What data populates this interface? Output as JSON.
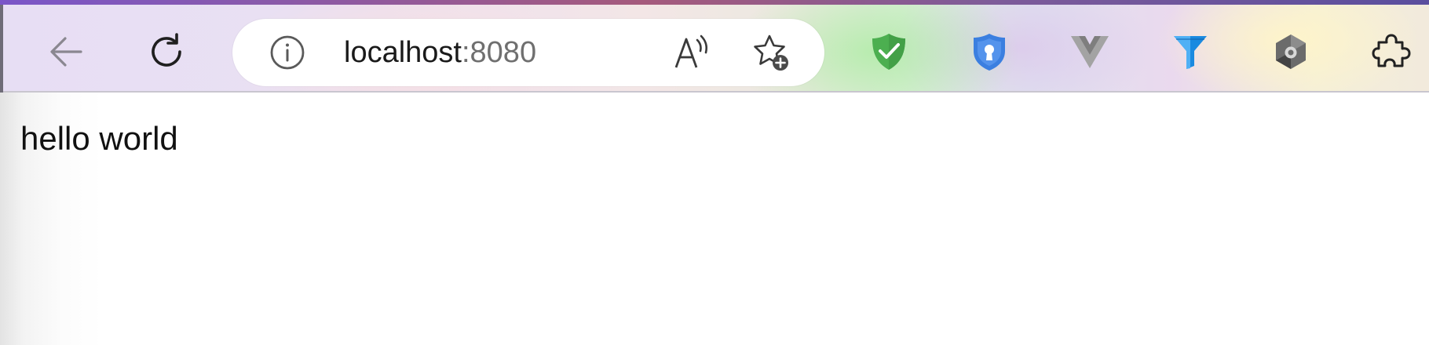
{
  "toolbar": {
    "back_icon": "arrow-left-icon",
    "reload_icon": "reload-icon"
  },
  "address_bar": {
    "host": "localhost",
    "port": ":8080",
    "info_icon": "info-icon",
    "read_aloud_icon": "read-aloud-icon",
    "favorite_icon": "star-add-icon"
  },
  "extensions": [
    {
      "icon": "shield-check-icon",
      "color": "#4caf50"
    },
    {
      "icon": "shield-keyhole-icon",
      "color": "#3b7fe0"
    },
    {
      "icon": "vue-logo-icon",
      "color": "#a0a0a0"
    },
    {
      "icon": "funnel-icon",
      "color": "#1a8ae0"
    },
    {
      "icon": "copilot-logo-icon",
      "color": "#555555"
    },
    {
      "icon": "puzzle-icon",
      "color": "#222222"
    }
  ],
  "page": {
    "text": "hello world"
  }
}
